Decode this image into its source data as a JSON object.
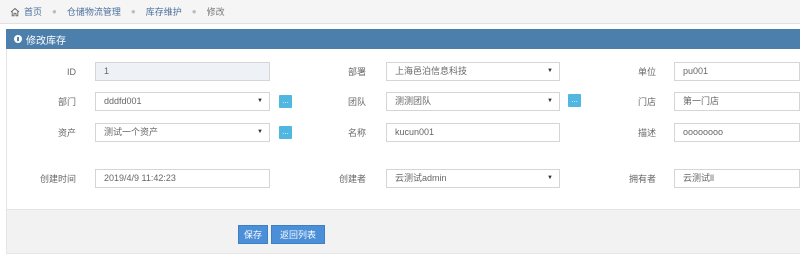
{
  "breadcrumb": [
    "首页",
    "仓储物流管理",
    "库存维护",
    "修改"
  ],
  "panel": {
    "title": "修改库存"
  },
  "form": {
    "id": {
      "label": "ID",
      "value": "1"
    },
    "org": {
      "label": "部署",
      "value": "上海邑泊信息科技"
    },
    "unit": {
      "label": "单位",
      "value": "pu001"
    },
    "dept": {
      "label": "部门",
      "value": "dddfd001"
    },
    "team": {
      "label": "团队",
      "value": "测测团队"
    },
    "store": {
      "label": "门店",
      "value": "第一门店"
    },
    "asset": {
      "label": "资产",
      "value": "测试一个资产"
    },
    "name": {
      "label": "名称",
      "value": "kucun001"
    },
    "desc": {
      "label": "描述",
      "value": "oooooooo"
    },
    "created_time": {
      "label": "创建时间",
      "value": "2019/4/9 11:42:23"
    },
    "creator": {
      "label": "创建者",
      "value": "云测试admin"
    },
    "owner": {
      "label": "拥有者",
      "value": "云测试ll"
    }
  },
  "add_label": "...",
  "buttons": {
    "save": "保存",
    "back": "返回列表"
  }
}
